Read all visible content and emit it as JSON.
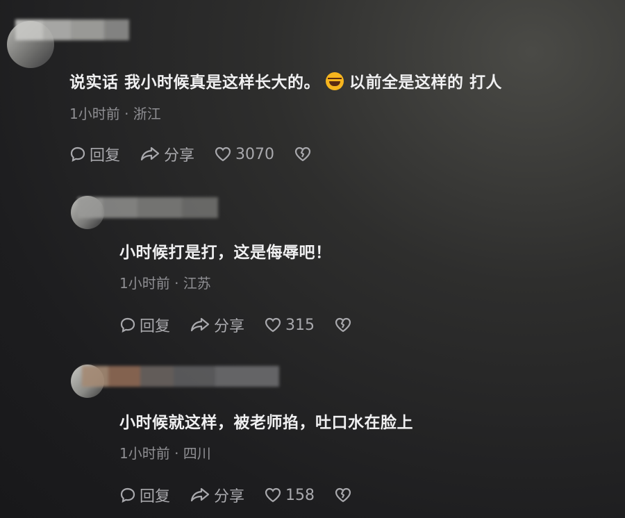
{
  "comments": [
    {
      "text_a": "说实话 我小时候真是这样长大的。",
      "emoji": "rofl-emoji",
      "text_b": "以前全是这样的 打人",
      "time": "1小时前 · 浙江",
      "reply": "回复",
      "share": "分享",
      "likes": "3070"
    },
    {
      "text": "小时候打是打，这是侮辱吧！",
      "time": "1小时前 · 江苏",
      "reply": "回复",
      "share": "分享",
      "likes": "315"
    },
    {
      "text": "小时候就这样，被老师掐，吐口水在脸上",
      "time": "1小时前 · 四川",
      "reply": "回复",
      "share": "分享",
      "likes": "158"
    }
  ],
  "colors": {
    "text": "#f0f0f1",
    "meta": "#8f8f93",
    "action": "#a9a9ad"
  }
}
